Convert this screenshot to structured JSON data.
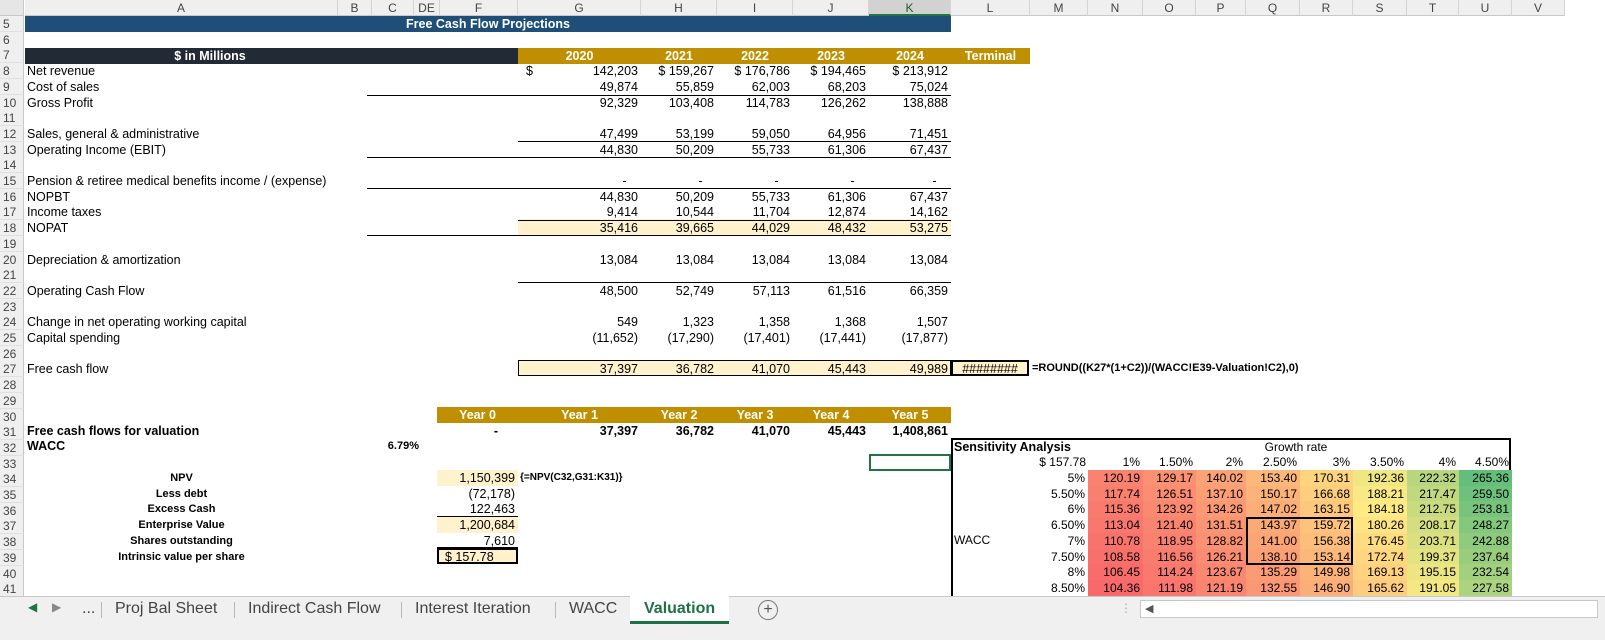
{
  "columns": [
    "A",
    "B",
    "C",
    "DE",
    "F",
    "G",
    "H",
    "I",
    "J",
    "K",
    "L",
    "M",
    "N",
    "O",
    "P",
    "Q",
    "R",
    "S",
    "T",
    "U",
    "V"
  ],
  "rows": [
    "5",
    "6",
    "7",
    "8",
    "9",
    "10",
    "11",
    "12",
    "13",
    "14",
    "15",
    "16",
    "17",
    "18",
    "19",
    "20",
    "21",
    "22",
    "23",
    "24",
    "25",
    "26",
    "27",
    "28",
    "29",
    "30",
    "31",
    "32",
    "33",
    "34",
    "35",
    "36",
    "37",
    "38",
    "39",
    "40",
    "41"
  ],
  "title": "Free Cash Flow Projections",
  "header": {
    "units": "$ in Millions",
    "years": [
      "2020",
      "2021",
      "2022",
      "2023",
      "2024"
    ],
    "terminal": "Terminal"
  },
  "lines": [
    {
      "label": "Net revenue",
      "values": [
        "142,203",
        "$ 159,267",
        "$ 176,786",
        "$ 194,465",
        "$ 213,912"
      ],
      "prefix": "$"
    },
    {
      "label": "Cost of sales",
      "values": [
        "49,874",
        "55,859",
        "62,003",
        "68,203",
        "75,024"
      ]
    },
    {
      "label": "Gross Profit",
      "values": [
        "92,329",
        "103,408",
        "114,783",
        "126,262",
        "138,888"
      ]
    },
    {
      "label": "Sales, general & administrative",
      "values": [
        "47,499",
        "53,199",
        "59,050",
        "64,956",
        "71,451"
      ]
    },
    {
      "label": "Operating Income (EBIT)",
      "values": [
        "44,830",
        "50,209",
        "55,733",
        "61,306",
        "67,437"
      ]
    },
    {
      "label": "Pension & retiree medical benefits income / (expense)",
      "values": [
        "-",
        "-",
        "-",
        "-",
        "-"
      ]
    },
    {
      "label": "NOPBT",
      "values": [
        "44,830",
        "50,209",
        "55,733",
        "61,306",
        "67,437"
      ]
    },
    {
      "label": "Income taxes",
      "values": [
        "9,414",
        "10,544",
        "11,704",
        "12,874",
        "14,162"
      ]
    },
    {
      "label": "NOPAT",
      "values": [
        "35,416",
        "39,665",
        "44,029",
        "48,432",
        "53,275"
      ]
    },
    {
      "label": "Depreciation & amortization",
      "values": [
        "13,084",
        "13,084",
        "13,084",
        "13,084",
        "13,084"
      ]
    },
    {
      "label": "Operating Cash Flow",
      "values": [
        "48,500",
        "52,749",
        "57,113",
        "61,516",
        "66,359"
      ]
    },
    {
      "label": "Change in net operating working capital",
      "values": [
        "549",
        "1,323",
        "1,358",
        "1,368",
        "1,507"
      ]
    },
    {
      "label": "Capital spending",
      "values": [
        "(11,652)",
        "(17,290)",
        "(17,401)",
        "(17,441)",
        "(17,877)"
      ]
    },
    {
      "label": "Free cash flow",
      "values": [
        "37,397",
        "36,782",
        "41,070",
        "45,443",
        "49,989"
      ],
      "terminal": "########",
      "formula": "=ROUND((K27*(1+C2))/(WACC!E39-Valuation!C2),0)"
    }
  ],
  "valuation": {
    "year_headers": [
      "Year 0",
      "Year 1",
      "Year 2",
      "Year 3",
      "Year 4",
      "Year 5"
    ],
    "fcf_label": "Free cash flows for valuation",
    "fcf_values": [
      "-",
      "37,397",
      "36,782",
      "41,070",
      "45,443",
      "1,408,861"
    ],
    "wacc_label": "WACC",
    "wacc_value": "6.79%",
    "items": [
      {
        "label": "NPV",
        "value": "1,150,399"
      },
      {
        "label": "Less debt",
        "value": "(72,178)"
      },
      {
        "label": "Excess Cash",
        "value": "122,463"
      },
      {
        "label": "Enterprise Value",
        "value": "1,200,684"
      },
      {
        "label": "Shares outstanding",
        "value": "7,610"
      },
      {
        "label": "Intrinsic value per share",
        "value": "$   157.78"
      }
    ],
    "npv_formula": "{=NPV(C32,G31:K31)}"
  },
  "sensitivity": {
    "title": "Sensitivity Analysis",
    "growth_label": "Growth rate",
    "corner": "$ 157.78",
    "wacc_label": "WACC",
    "growth_rates": [
      "1%",
      "1.50%",
      "2%",
      "2.50%",
      "3%",
      "3.50%",
      "4%",
      "4.50%"
    ],
    "wacc_rates": [
      "5%",
      "5.50%",
      "6%",
      "6.50%",
      "7%",
      "7.50%",
      "8%",
      "8.50%"
    ],
    "values": [
      [
        "120.19",
        "129.17",
        "140.02",
        "153.40",
        "170.31",
        "192.36",
        "222.32",
        "265.36"
      ],
      [
        "117.74",
        "126.51",
        "137.10",
        "150.17",
        "166.68",
        "188.21",
        "217.47",
        "259.50"
      ],
      [
        "115.36",
        "123.92",
        "134.26",
        "147.02",
        "163.15",
        "184.18",
        "212.75",
        "253.81"
      ],
      [
        "113.04",
        "121.40",
        "131.51",
        "143.97",
        "159.72",
        "180.26",
        "208.17",
        "248.27"
      ],
      [
        "110.78",
        "118.95",
        "128.82",
        "141.00",
        "156.38",
        "176.45",
        "203.71",
        "242.88"
      ],
      [
        "108.58",
        "116.56",
        "126.21",
        "138.10",
        "153.14",
        "172.74",
        "199.37",
        "237.64"
      ],
      [
        "106.45",
        "114.24",
        "123.67",
        "135.29",
        "149.98",
        "169.13",
        "195.15",
        "232.54"
      ],
      [
        "104.36",
        "111.98",
        "121.19",
        "132.55",
        "146.90",
        "165.62",
        "191.05",
        "227.58"
      ]
    ]
  },
  "tabs": [
    "...",
    "Proj Bal Sheet",
    "Indirect Cash Flow",
    "Interest Iteration",
    "WACC",
    "Valuation"
  ],
  "active_tab": "Valuation",
  "add_sheet_icon": "plus-circle-icon",
  "colors": {
    "title_bar": "#1f4e79",
    "header_dark": "#222b35",
    "header_gold": "#bf8f00",
    "highlight": "#fff2cc"
  }
}
